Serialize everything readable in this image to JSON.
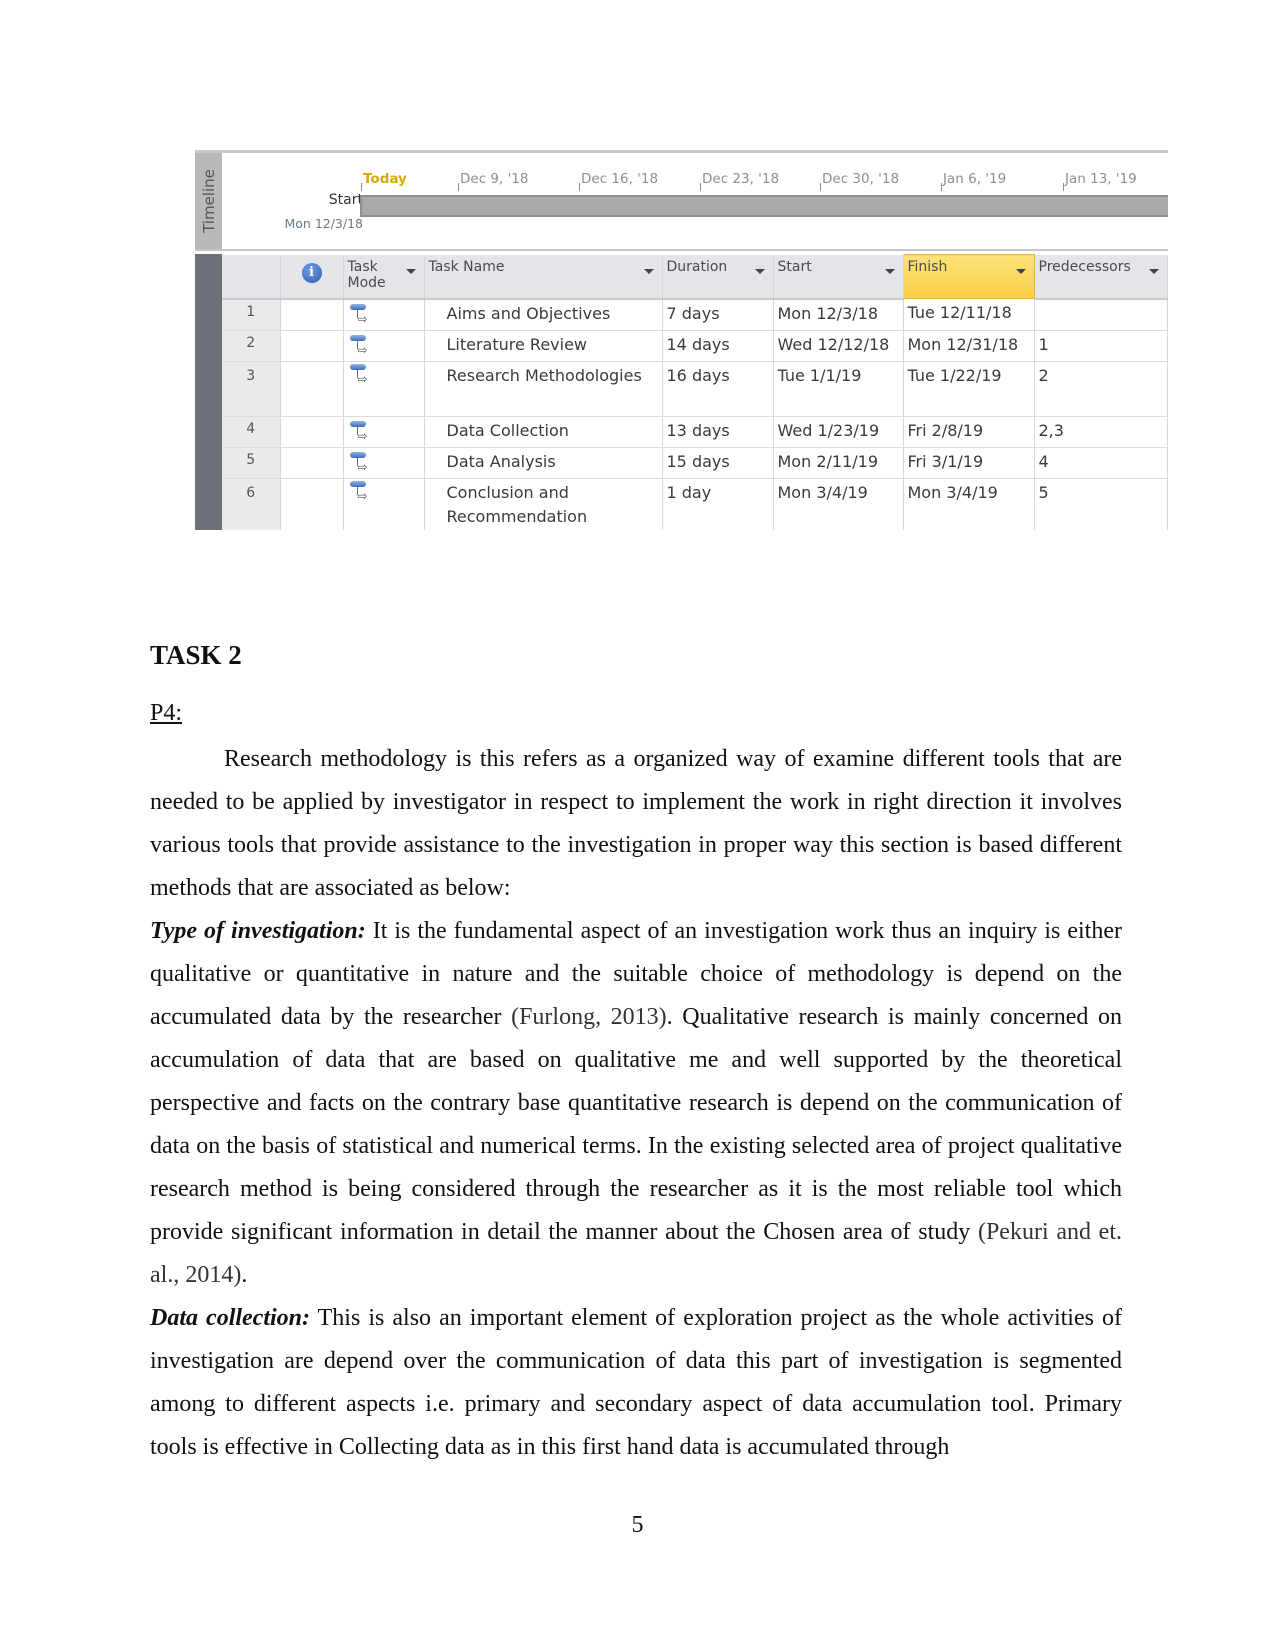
{
  "project_screenshot": {
    "timeline": {
      "tab_label": "Timeline",
      "start_label": "Start",
      "start_date": "Mon 12/3/18",
      "today_label": "Today",
      "ticks": [
        "Dec 9, '18",
        "Dec 16, '18",
        "Dec 23, '18",
        "Dec 30, '18",
        "Jan 6, '19",
        "Jan 13, '19"
      ]
    },
    "table": {
      "columns": {
        "info": "i",
        "task_mode": "Task Mode",
        "task_name": "Task Name",
        "duration": "Duration",
        "start": "Start",
        "finish": "Finish",
        "predecessors": "Predecessors"
      },
      "highlight_color": "#f8cf45",
      "rows": [
        {
          "id": "1",
          "name": "Aims and Objectives",
          "duration": "7 days",
          "start": "Mon 12/3/18",
          "finish": "Tue 12/11/18",
          "predecessors": ""
        },
        {
          "id": "2",
          "name": "Literature Review",
          "duration": "14 days",
          "start": "Wed 12/12/18",
          "finish": "Mon 12/31/18",
          "predecessors": "1"
        },
        {
          "id": "3",
          "name": "Research Methodologies",
          "duration": "16 days",
          "start": "Tue 1/1/19",
          "finish": "Tue 1/22/19",
          "predecessors": "2"
        },
        {
          "id": "4",
          "name": "Data Collection",
          "duration": "13 days",
          "start": "Wed 1/23/19",
          "finish": "Fri 2/8/19",
          "predecessors": "2,3"
        },
        {
          "id": "5",
          "name": "Data Analysis",
          "duration": "15 days",
          "start": "Mon 2/11/19",
          "finish": "Fri 3/1/19",
          "predecessors": "4"
        },
        {
          "id": "6",
          "name": "Conclusion and Recommendation",
          "duration": "1 day",
          "start": "Mon 3/4/19",
          "finish": "Mon 3/4/19",
          "predecessors": "5"
        }
      ]
    }
  },
  "document": {
    "heading": "TASK 2",
    "subheading": "P4: ",
    "paragraphs": {
      "intro": "Research methodology is this refers as a organized way of examine different tools that are needed to be applied by investigator in respect to implement the work in right direction it involves various tools that provide assistance to the investigation in proper way this section is based different methods that are associated as below:",
      "type_lead": "Type of investigation:",
      "type_text_1": " It is the fundamental aspect of an investigation work thus an inquiry is either qualitative or quantitative in nature and the suitable choice of methodology is depend on the accumulated data by the researcher ",
      "type_cite_1": "(Furlong, 2013)",
      "type_text_2": ". Qualitative research is mainly concerned on accumulation of data that are based on qualitative me and well supported by the theoretical perspective and facts on the contrary base quantitative research is depend on the communication of data on the basis of statistical and numerical terms. In the existing selected area of project qualitative research method is being considered through the researcher as it is the most reliable tool which provide significant information in detail the manner about the Chosen area of study ",
      "type_cite_2": "(Pekuri and et. al., 2014)",
      "type_text_3": ".",
      "data_lead": "Data collection:",
      "data_text": " This is also an important element of exploration project as the whole activities of investigation are depend over the communication of data this part of investigation is segmented among to different aspects i.e. primary and secondary aspect of data accumulation tool. Primary tools is effective in Collecting data as in this first hand data is accumulated through"
    },
    "page_number": "5"
  }
}
